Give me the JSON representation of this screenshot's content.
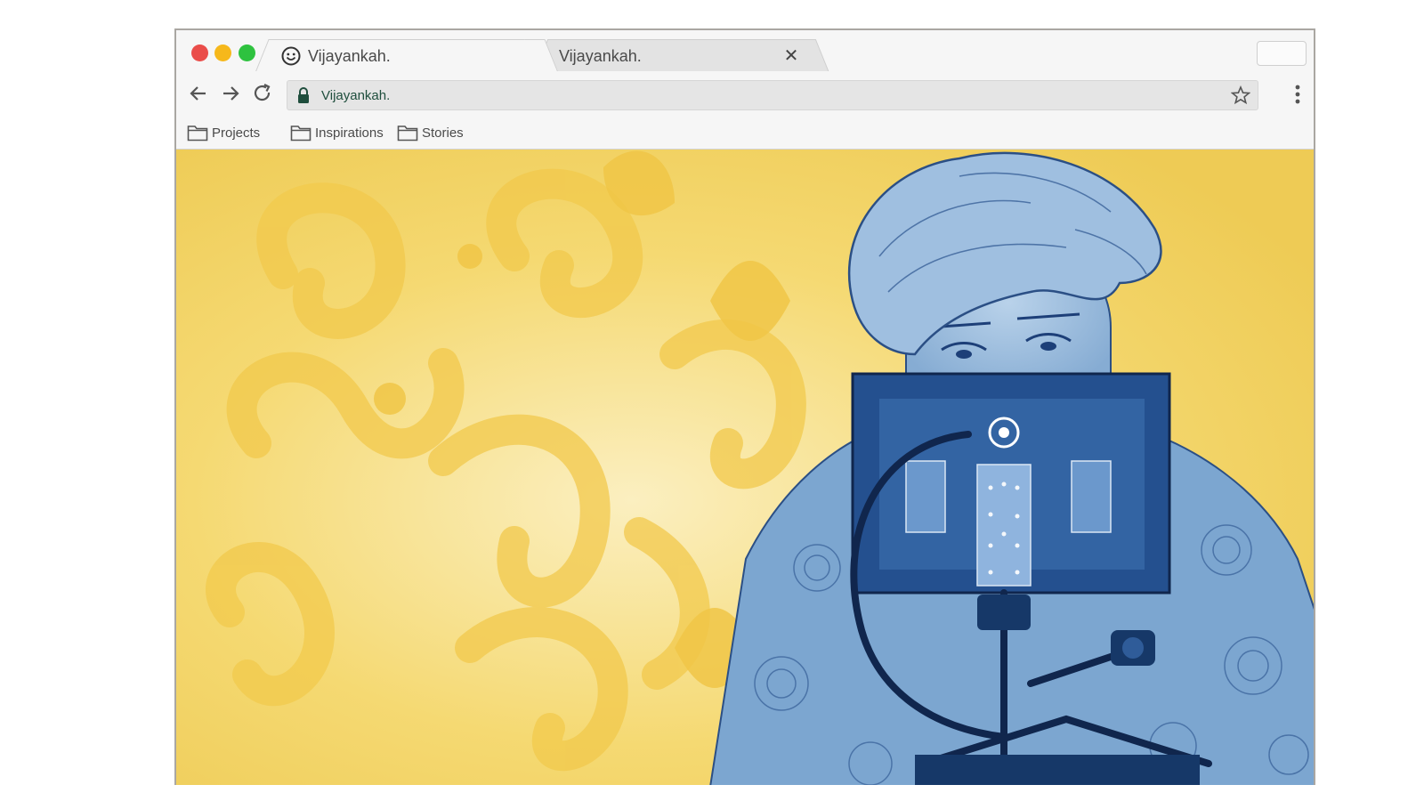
{
  "window": {
    "tabs": [
      {
        "title": "Vijayankah.",
        "active": true,
        "favicon": "smiley-icon"
      },
      {
        "title": "Vijayankah.",
        "active": false,
        "close_icon": "close-icon"
      }
    ]
  },
  "toolbar": {
    "url": "Vijayankah.",
    "icons": [
      "back-arrow-icon",
      "forward-arrow-icon",
      "reload-icon",
      "lock-icon",
      "star-icon",
      "menu-icon"
    ]
  },
  "bookmarks": [
    {
      "label": "Projects",
      "icon": "folder-icon"
    },
    {
      "label": "Inspirations",
      "icon": "folder-icon"
    },
    {
      "label": "Stories",
      "icon": "folder-icon"
    }
  ],
  "content": {
    "image": "illustration-person-with-camera-rig",
    "colors": {
      "background_yellow": "#f3cf5a",
      "figure_blue": "#7ea6cf",
      "dark_blue": "#1d3f78"
    }
  }
}
